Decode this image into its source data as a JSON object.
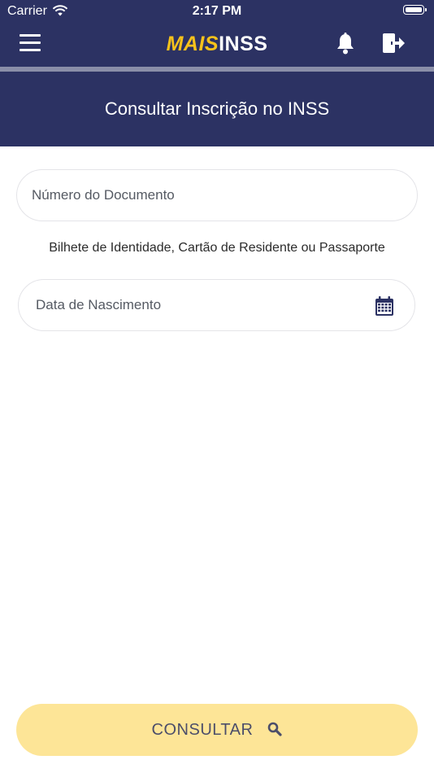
{
  "status_bar": {
    "carrier": "Carrier",
    "time": "2:17 PM",
    "icons": [
      "wifi-icon",
      "battery-icon"
    ]
  },
  "header": {
    "logo_part1": "MAIS",
    "logo_part2": "INSS",
    "icons": [
      "hamburger-menu-icon",
      "bell-icon",
      "logout-icon"
    ],
    "background_color": "#2c3263",
    "logo_accent_color": "#f6c21b"
  },
  "page": {
    "title": "Consultar Inscrição no INSS"
  },
  "form": {
    "document_placeholder": "Número do Documento",
    "document_value": "",
    "document_hint": "Bilhete de Identidade, Cartão de Residente ou Passaporte",
    "birthdate_placeholder": "Data de Nascimento",
    "birthdate_value": "",
    "calendar_icon": "calendar-icon"
  },
  "actions": {
    "consult_label": "CONSULTAR",
    "consult_icon": "search-icon",
    "button_color": "#fde597"
  }
}
